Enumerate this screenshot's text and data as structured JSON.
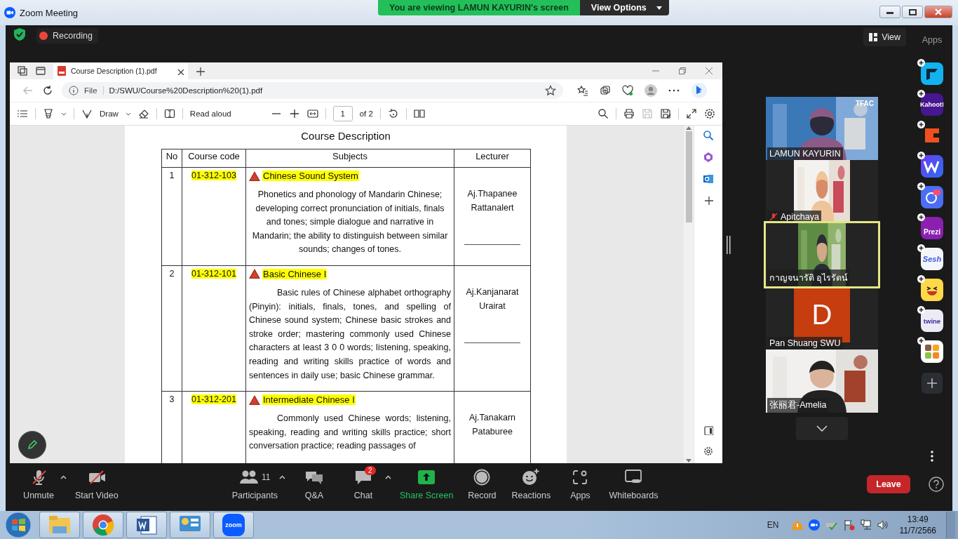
{
  "window": {
    "title": "Zoom Meeting"
  },
  "share_banner": {
    "text": "You are viewing LAMUN KAYURIN's screen",
    "button": "View Options"
  },
  "top_bar": {
    "recording": "Recording",
    "view": "View",
    "apps_label": "Apps"
  },
  "browser": {
    "tab": "Course Description (1).pdf",
    "address_prefix": "File",
    "url": "D:/SWU/Course%20Description%20(1).pdf",
    "pdf_toolbar": {
      "draw": "Draw",
      "read_aloud": "Read aloud",
      "page": "1",
      "page_count": "of 2"
    }
  },
  "document": {
    "title": "Course Description",
    "columns": [
      "No",
      "Course code",
      "Subjects",
      "Lecturer"
    ],
    "rows": [
      {
        "no": "1",
        "code": "01-312-103",
        "subject": "Chinese Sound System",
        "description": "Phonetics and phonology of Mandarin Chinese; developing correct pronunciation of initials, finals and tones; simple dialogue and narrative in Mandarin; the ability to distinguish between similar sounds; changes of tones.",
        "lecturer": "Aj.Thapanee Rattanalert"
      },
      {
        "no": "2",
        "code": "01-312-101",
        "subject": "Basic Chinese I",
        "description": "Basic rules of Chinese alphabet orthography (Pinyin): initials, finals, tones, and spelling of Chinese sound system; Chinese basic strokes and stroke order; mastering commonly used Chinese characters at least 3 0 0 words; listening, speaking, reading and writing skills practice of words and sentences in daily use; basic Chinese grammar.",
        "lecturer": "Aj.Kanjanarat Urairat"
      },
      {
        "no": "3",
        "code": "01-312-201",
        "subject": "Intermediate Chinese I",
        "description": "Commonly used Chinese words; listening, speaking, reading and writing skills practice; short conversation practice; reading passages of",
        "lecturer": "Aj.Tanakarn Pataburee"
      }
    ]
  },
  "participants": [
    {
      "name": "LAMUN KAYURIN",
      "kind": "video",
      "overlay": "TFAC",
      "muted": false,
      "speaking": false
    },
    {
      "name": "Apitchaya",
      "kind": "portrait_video",
      "muted": true,
      "speaking": false
    },
    {
      "name": "กาญจนารัติ อุไรรัตน์",
      "kind": "portrait_video",
      "muted": false,
      "speaking": true
    },
    {
      "name": "Pan Shuang SWU",
      "kind": "avatar",
      "initial": "D",
      "muted": false,
      "speaking": false
    },
    {
      "name": "张丽君-Amelia",
      "kind": "video",
      "muted": false,
      "speaking": false
    }
  ],
  "apps": [
    {
      "kind": "arrow"
    },
    {
      "kind": "kahoot",
      "label": "Kahoot!"
    },
    {
      "kind": "c"
    },
    {
      "kind": "w"
    },
    {
      "kind": "ai"
    },
    {
      "kind": "prezi",
      "label": "Prezi"
    },
    {
      "kind": "sesh",
      "label": "Sesh"
    },
    {
      "kind": "emoji"
    },
    {
      "kind": "twine",
      "label": "twine"
    },
    {
      "kind": "grid"
    }
  ],
  "toolbar": [
    {
      "kind": "mic",
      "label": "Unmute",
      "off": true,
      "caret": true
    },
    {
      "kind": "video",
      "label": "Start Video",
      "off": true,
      "caret": false
    },
    {
      "kind": "participants",
      "label": "Participants",
      "count": "11",
      "caret": true
    },
    {
      "kind": "qa",
      "label": "Q&A",
      "caret": false
    },
    {
      "kind": "chat",
      "label": "Chat",
      "badge": "2",
      "caret": true
    },
    {
      "kind": "share",
      "label": "Share Screen",
      "caret": false
    },
    {
      "kind": "record",
      "label": "Record",
      "caret": false
    },
    {
      "kind": "reactions",
      "label": "Reactions",
      "caret": false
    },
    {
      "kind": "apps",
      "label": "Apps",
      "caret": false
    },
    {
      "kind": "whiteboard",
      "label": "Whiteboards",
      "caret": false
    }
  ],
  "leave": "Leave",
  "taskbar": {
    "apps": [
      {
        "kind": "explorer"
      },
      {
        "kind": "chrome"
      },
      {
        "kind": "word"
      },
      {
        "kind": "control"
      },
      {
        "kind": "zoom",
        "label": "zoom"
      }
    ],
    "language": "EN",
    "time": "13:49",
    "date": "11/7/2566"
  }
}
